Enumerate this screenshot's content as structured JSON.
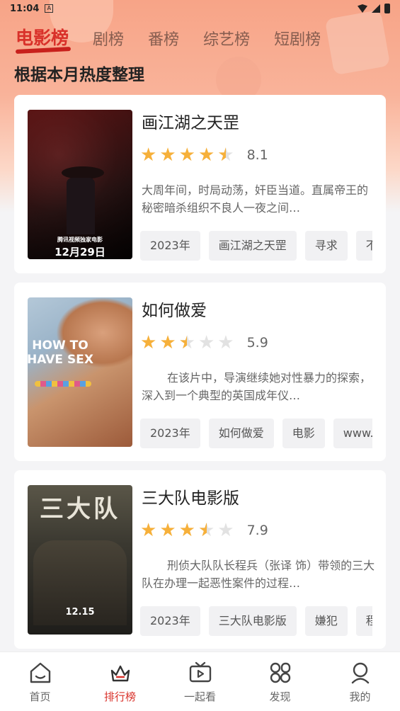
{
  "status_bar": {
    "time": "11:04",
    "sim_label": "A"
  },
  "tabs": [
    {
      "label": "电影榜",
      "active": true
    },
    {
      "label": "剧榜",
      "active": false
    },
    {
      "label": "番榜",
      "active": false
    },
    {
      "label": "综艺榜",
      "active": false
    },
    {
      "label": "短剧榜",
      "active": false
    }
  ],
  "subtitle": "根据本月热度整理",
  "movies": [
    {
      "title": "画江湖之天罡",
      "rating": 4.5,
      "score": "8.1",
      "description": "大周年间，时局动荡，奸臣当道。直属帝王的秘密暗杀组织不良人一夜之间…",
      "tags": [
        "2023年",
        "画江湖之天罡",
        "寻求",
        "不良人"
      ],
      "poster_caption": "12月29日",
      "poster_small": "腾讯视频独家电影"
    },
    {
      "title": "如何做爱",
      "rating": 2.5,
      "score": "5.9",
      "description": "在该片中，导演继续她对性暴力的探索，深入到一个典型的英国成年仪…",
      "tags": [
        "2023年",
        "如何做爱",
        "电影",
        "www.a"
      ],
      "poster_caption": "HOW TO HAVE SEX"
    },
    {
      "title": "三大队电影版",
      "rating": 3.5,
      "score": "7.9",
      "description": "刑侦大队队长程兵（张译 饰）带领的三大队在办理一起恶性案件的过程…",
      "tags": [
        "2023年",
        "三大队电影版",
        "嫌犯",
        "程兵"
      ],
      "poster_caption": "三大队",
      "poster_date": "12.15"
    }
  ],
  "bottom_nav": [
    {
      "label": "首页",
      "icon": "home-icon",
      "active": false
    },
    {
      "label": "排行榜",
      "icon": "ranking-crown-icon",
      "active": true
    },
    {
      "label": "一起看",
      "icon": "tv-play-icon",
      "active": false
    },
    {
      "label": "发现",
      "icon": "discover-grid-icon",
      "active": false
    },
    {
      "label": "我的",
      "icon": "profile-icon",
      "active": false
    }
  ],
  "colors": {
    "accent": "#d9312a",
    "star": "#f6b03a",
    "star_empty": "#e2e2e2"
  }
}
